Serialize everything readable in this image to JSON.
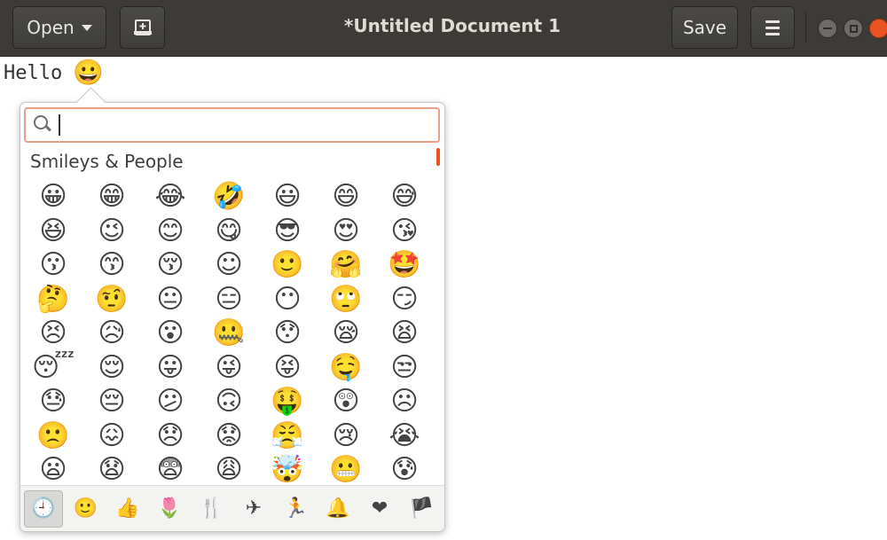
{
  "window": {
    "title": "*Untitled Document 1",
    "open_label": "Open",
    "save_label": "Save"
  },
  "editor": {
    "text": "Hello",
    "inserted_emoji": "😀"
  },
  "emoji_picker": {
    "search": {
      "value": "",
      "placeholder": ""
    },
    "section_title": "Smileys & People",
    "emojis": [
      "😀",
      "😁",
      "😂",
      "🤣",
      "😃",
      "😄",
      "😅",
      "😆",
      "😉",
      "😊",
      "😋",
      "😎",
      "😍",
      "😘",
      "😗",
      "😙",
      "😚",
      "☺",
      "🙂",
      "🤗",
      "🤩",
      "🤔",
      "🤨",
      "😐",
      "😑",
      "😶",
      "🙄",
      "😏",
      "😣",
      "😥",
      "😮",
      "🤐",
      "😯",
      "😪",
      "😫",
      "😴",
      "😌",
      "😛",
      "😜",
      "😝",
      "🤤",
      "😒",
      "😓",
      "😔",
      "😕",
      "🙃",
      "🤑",
      "😲",
      "☹",
      "🙁",
      "😖",
      "😞",
      "😟",
      "😤",
      "😢",
      "😭",
      "😦",
      "😧",
      "😨",
      "😩",
      "🤯",
      "😬",
      "😰"
    ],
    "categories": [
      {
        "name": "recent",
        "glyph": "🕘"
      },
      {
        "name": "smileys",
        "glyph": "🙂"
      },
      {
        "name": "body",
        "glyph": "👍"
      },
      {
        "name": "nature",
        "glyph": "🌷"
      },
      {
        "name": "food",
        "glyph": "🍴"
      },
      {
        "name": "travel",
        "glyph": "✈"
      },
      {
        "name": "activities",
        "glyph": "🏃"
      },
      {
        "name": "objects",
        "glyph": "🔔"
      },
      {
        "name": "symbols",
        "glyph": "❤"
      },
      {
        "name": "flags",
        "glyph": "🏴"
      }
    ],
    "active_category": "recent"
  },
  "colors": {
    "headerbar": "#3c3b37",
    "accent": "#e95420"
  }
}
